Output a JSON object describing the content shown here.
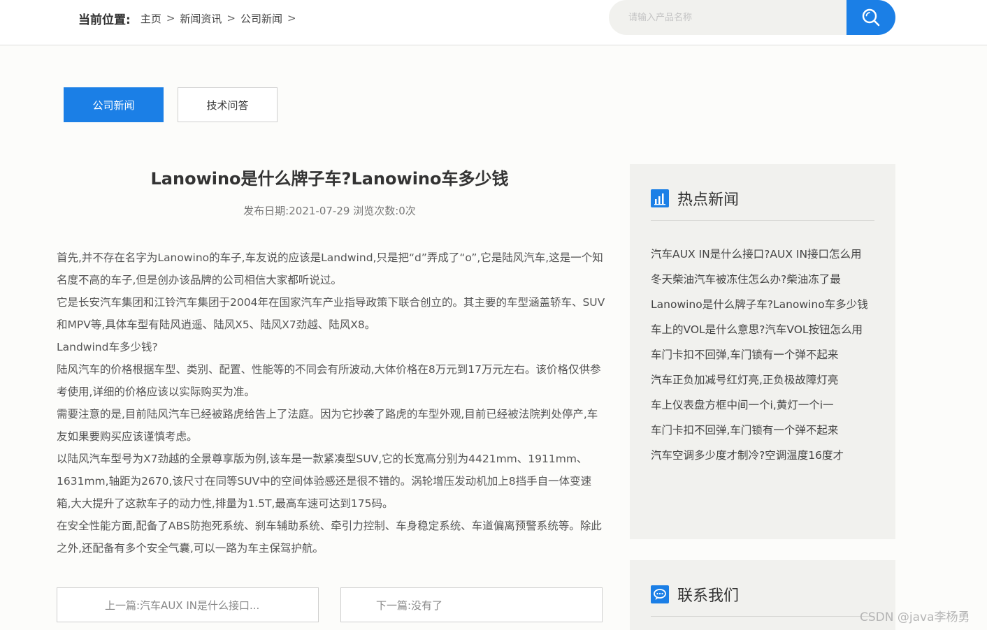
{
  "breadcrumb": {
    "label": "当前位置:",
    "items": [
      "主页",
      "新闻资讯",
      "公司新闻"
    ],
    "separator": ">"
  },
  "search": {
    "placeholder": "请输入产品名称",
    "button_icon": "search-icon"
  },
  "tabs": [
    {
      "label": "公司新闻",
      "active": true
    },
    {
      "label": "技术问答",
      "active": false
    }
  ],
  "article": {
    "title": "Lanowino是什么牌子车?Lanowino车多少钱",
    "meta_date_label": "发布日期:",
    "meta_date": "2021-07-29",
    "meta_views_label": "浏览次数:",
    "meta_views": "0次",
    "paragraphs": [
      "首先,并不存在名字为Lanowino的车子,车友说的应该是Landwind,只是把“d”弄成了“o”,它是陆风汽车,这是一个知名度不高的车子,但是创办该品牌的公司相信大家都听说过。",
      "它是长安汽车集团和江铃汽车集团于2004年在国家汽车产业指导政策下联合创立的。其主要的车型涵盖轿车、SUV和MPV等,具体车型有陆风逍遥、陆风X5、陆风X7劲越、陆风X8。",
      "Landwind车多少钱?",
      "陆风汽车的价格根据车型、类别、配置、性能等的不同会有所波动,大体价格在8万元到17万元左右。该价格仅供参考使用,详细的价格应该以实际购买为准。",
      "需要注意的是,目前陆风汽车已经被路虎给告上了法庭。因为它抄袭了路虎的车型外观,目前已经被法院判处停产,车友如果要购买应该谨慎考虑。",
      "以陆风汽车型号为X7劲越的全景尊享版为例,该车是一款紧凑型SUV,它的长宽高分别为4421mm、1911mm、1631mm,轴距为2670,该尺寸在同等SUV中的空间体验感还是很不错的。涡轮增压发动机加上8挡手自一体变速箱,大大提升了这款车子的动力性,排量为1.5T,最高车速可达到175码。",
      "在安全性能方面,配备了ABS防抱死系统、刹车辅助系统、牵引力控制、车身稳定系统、车道偏离预警系统等。除此之外,还配备有多个安全气囊,可以一路为车主保驾护航。"
    ],
    "prev": "上一篇:汽车AUX IN是什么接口...",
    "next": "下一篇:没有了"
  },
  "sidebar": {
    "hot_title": "热点新闻",
    "hot_icon": "bar-chart-icon",
    "hot_items": [
      "汽车AUX IN是什么接口?AUX IN接口怎么用",
      "冬天柴油汽车被冻住怎么办?柴油冻了最",
      "Lanowino是什么牌子车?Lanowino车多少钱",
      "车上的VOL是什么意思?汽车VOL按钮怎么用",
      "车门卡扣不回弹,车门锁有一个弹不起来",
      "汽车正负加减号红灯亮,正负极故障灯亮",
      "车上仪表盘方框中间一个i,黄灯一个i一",
      "车门卡扣不回弹,车门锁有一个弹不起来",
      "汽车空调多少度才制冷?空调温度16度才"
    ],
    "contact_title": "联系我们",
    "contact_icon": "chat-bubble-icon"
  },
  "watermark": "CSDN @java李杨勇",
  "colors": {
    "accent": "#1b7fe6",
    "page_bg": "#fcfcfa",
    "sidebar_bg": "#f1f1ee"
  }
}
